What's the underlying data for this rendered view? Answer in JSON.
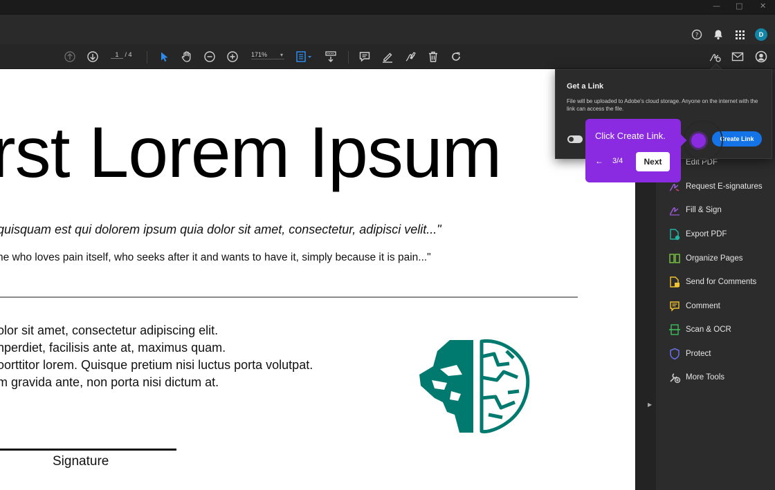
{
  "titlebar": {
    "minimize": "—",
    "maximize": "□",
    "close": "✕"
  },
  "header": {
    "help_icon": "help-circle-icon",
    "notifications_icon": "bell-icon",
    "apps_icon": "apps-grid-icon",
    "avatar_initial": "D"
  },
  "toolbar": {
    "current_page": "1",
    "total_pages": "/ 4",
    "zoom": "171%"
  },
  "document": {
    "title": "rst Lorem Ipsum",
    "quote": "quisquam est qui dolorem ipsum quia dolor sit amet, consectetur, adipisci velit...\"",
    "quote_translation": "ne who loves pain itself, who seeks after it and wants to have it, simply because it is pain...\"",
    "body_lines": [
      "olor sit amet, consectetur adipiscing elit.",
      "nperdiet, facilisis ante at, maximus quam.",
      "oorttitor lorem. Quisque pretium nisi luctus porta volutpat.",
      "m gravida ante, non porta nisi dictum at."
    ],
    "signature_label": "Signature",
    "logo_color": "#007a6e"
  },
  "popover": {
    "title": "Get a Link",
    "description": "File will be uploaded to Adobe's cloud storage. Anyone on the internet with the link can access the file.",
    "create_button": "Create Link"
  },
  "guide": {
    "text": "Click Create Link.",
    "back": "←",
    "step": "3/4",
    "next": "Next",
    "color": "#8a2be2"
  },
  "tools": [
    {
      "label": "Edit PDF",
      "icon": "edit-pdf-icon",
      "color": "#e0457b"
    },
    {
      "label": "Request E-signatures",
      "icon": "request-esign-icon",
      "color": "#9c5bd8"
    },
    {
      "label": "Fill & Sign",
      "icon": "fill-sign-icon",
      "color": "#9c5bd8"
    },
    {
      "label": "Export PDF",
      "icon": "export-pdf-icon",
      "color": "#22b5a4"
    },
    {
      "label": "Organize Pages",
      "icon": "organize-pages-icon",
      "color": "#7ac943"
    },
    {
      "label": "Send for Comments",
      "icon": "send-comments-icon",
      "color": "#f4c430"
    },
    {
      "label": "Comment",
      "icon": "comment-icon",
      "color": "#f4c430"
    },
    {
      "label": "Scan & OCR",
      "icon": "scan-ocr-icon",
      "color": "#3dbf5c"
    },
    {
      "label": "Protect",
      "icon": "protect-icon",
      "color": "#6b72e8"
    },
    {
      "label": "More Tools",
      "icon": "more-tools-icon",
      "color": "#cccccc"
    }
  ]
}
